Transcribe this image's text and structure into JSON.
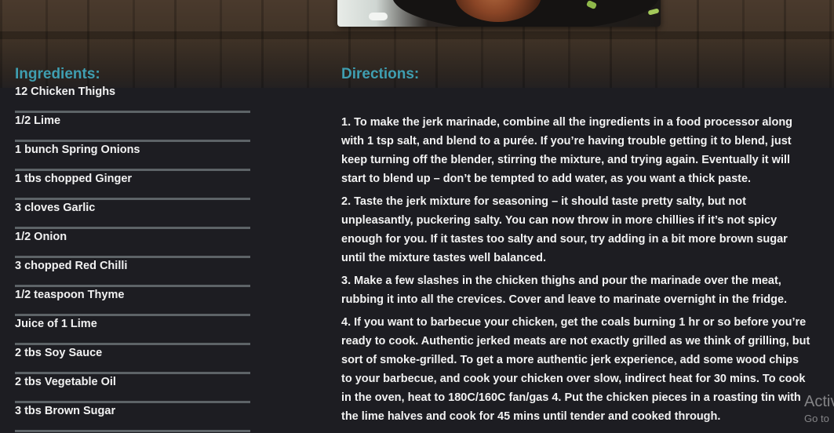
{
  "ingredients": {
    "title": "Ingredients:",
    "items": [
      "12 Chicken Thighs",
      "1/2 Lime",
      "1 bunch Spring Onions",
      "1 tbs chopped Ginger",
      "3 cloves Garlic",
      "1/2 Onion",
      "3 chopped Red Chilli",
      "1/2 teaspoon Thyme",
      "Juice of 1 Lime",
      "2 tbs Soy Sauce",
      "2 tbs Vegetable Oil",
      "3 tbs Brown Sugar"
    ]
  },
  "directions": {
    "title": "Directions:",
    "steps": [
      "1. To make the jerk marinade, combine all the ingredients in a food processor along with 1 tsp salt, and blend to a purée. If you’re having trouble getting it to blend, just keep turning off the blender, stirring the mixture, and trying again. Eventually it will start to blend up – don’t be tempted to add water, as you want a thick paste.",
      "2. Taste the jerk mixture for seasoning – it should taste pretty salty, but not unpleasantly, puckering salty. You can now throw in more chillies if it’s not spicy enough for you. If it tastes too salty and sour, try adding in a bit more brown sugar until the mixture tastes well balanced.",
      "3. Make a few slashes in the chicken thighs and pour the marinade over the meat, rubbing it into all the crevices. Cover and leave to marinate overnight in the fridge.",
      "4. If you want to barbecue your chicken, get the coals burning 1 hr or so before you’re ready to cook. Authentic jerked meats are not exactly grilled as we think of grilling, but sort of smoke-grilled. To get a more authentic jerk experience, add some wood chips to your barbecue, and cook your chicken over slow, indirect heat for 30 mins. To cook in the oven, heat to 180C/160C fan/gas 4. Put the chicken pieces in a roasting tin with the lime halves and cook for 45 mins until tender and cooked through."
    ]
  },
  "watermark": {
    "line1": "Activ",
    "line2": "Go to"
  },
  "colors": {
    "accent": "#3f9eb0",
    "text": "#f2f2f2",
    "divider": "#5d6367",
    "background": "#1d1d22"
  }
}
